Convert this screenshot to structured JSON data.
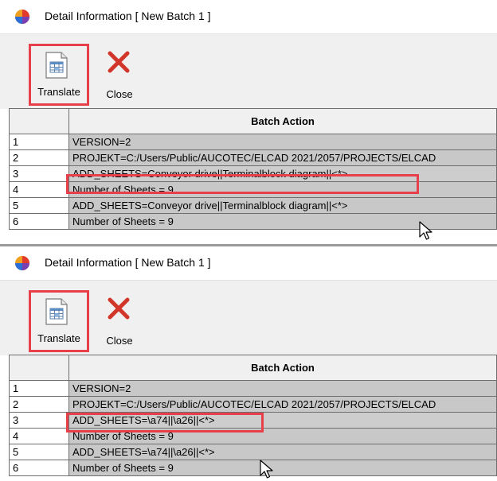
{
  "colors": {
    "highlight": "#e8404a",
    "toolbar_bg": "#f0f0f0",
    "cell_bg": "#c8c8c8",
    "close_red": "#d2362a"
  },
  "top_panel": {
    "title": "Detail Information [ New Batch 1 ]",
    "app_icon": "app-logo-icon",
    "toolbar": {
      "translate_label": "Translate",
      "close_label": "Close",
      "translate_icon": "table-translate-icon",
      "close_icon": "close-x-icon"
    },
    "table": {
      "header": "Batch Action",
      "rows": [
        {
          "num": "1",
          "action": "VERSION=2"
        },
        {
          "num": "2",
          "action": "PROJEKT=C:/Users/Public/AUCOTEC/ELCAD 2021/2057/PROJECTS/ELCAD"
        },
        {
          "num": "3",
          "action": "ADD_SHEETS=Conveyor drive||Terminalblock diagram||<*>"
        },
        {
          "num": "4",
          "action": "Number of Sheets = 9"
        },
        {
          "num": "5",
          "action": "ADD_SHEETS=Conveyor drive||Terminalblock diagram||<*>"
        },
        {
          "num": "6",
          "action": "Number of Sheets = 9"
        }
      ]
    }
  },
  "bottom_panel": {
    "title": "Detail Information [ New Batch 1 ]",
    "app_icon": "app-logo-icon",
    "toolbar": {
      "translate_label": "Translate",
      "close_label": "Close",
      "translate_icon": "table-translate-icon",
      "close_icon": "close-x-icon"
    },
    "table": {
      "header": "Batch Action",
      "rows": [
        {
          "num": "1",
          "action": "VERSION=2"
        },
        {
          "num": "2",
          "action": "PROJEKT=C:/Users/Public/AUCOTEC/ELCAD 2021/2057/PROJECTS/ELCAD"
        },
        {
          "num": "3",
          "action": "ADD_SHEETS=\\a74||\\a26||<*>"
        },
        {
          "num": "4",
          "action": "Number of Sheets = 9"
        },
        {
          "num": "5",
          "action": "ADD_SHEETS=\\a74||\\a26||<*>"
        },
        {
          "num": "6",
          "action": "Number of Sheets = 9"
        }
      ]
    }
  }
}
